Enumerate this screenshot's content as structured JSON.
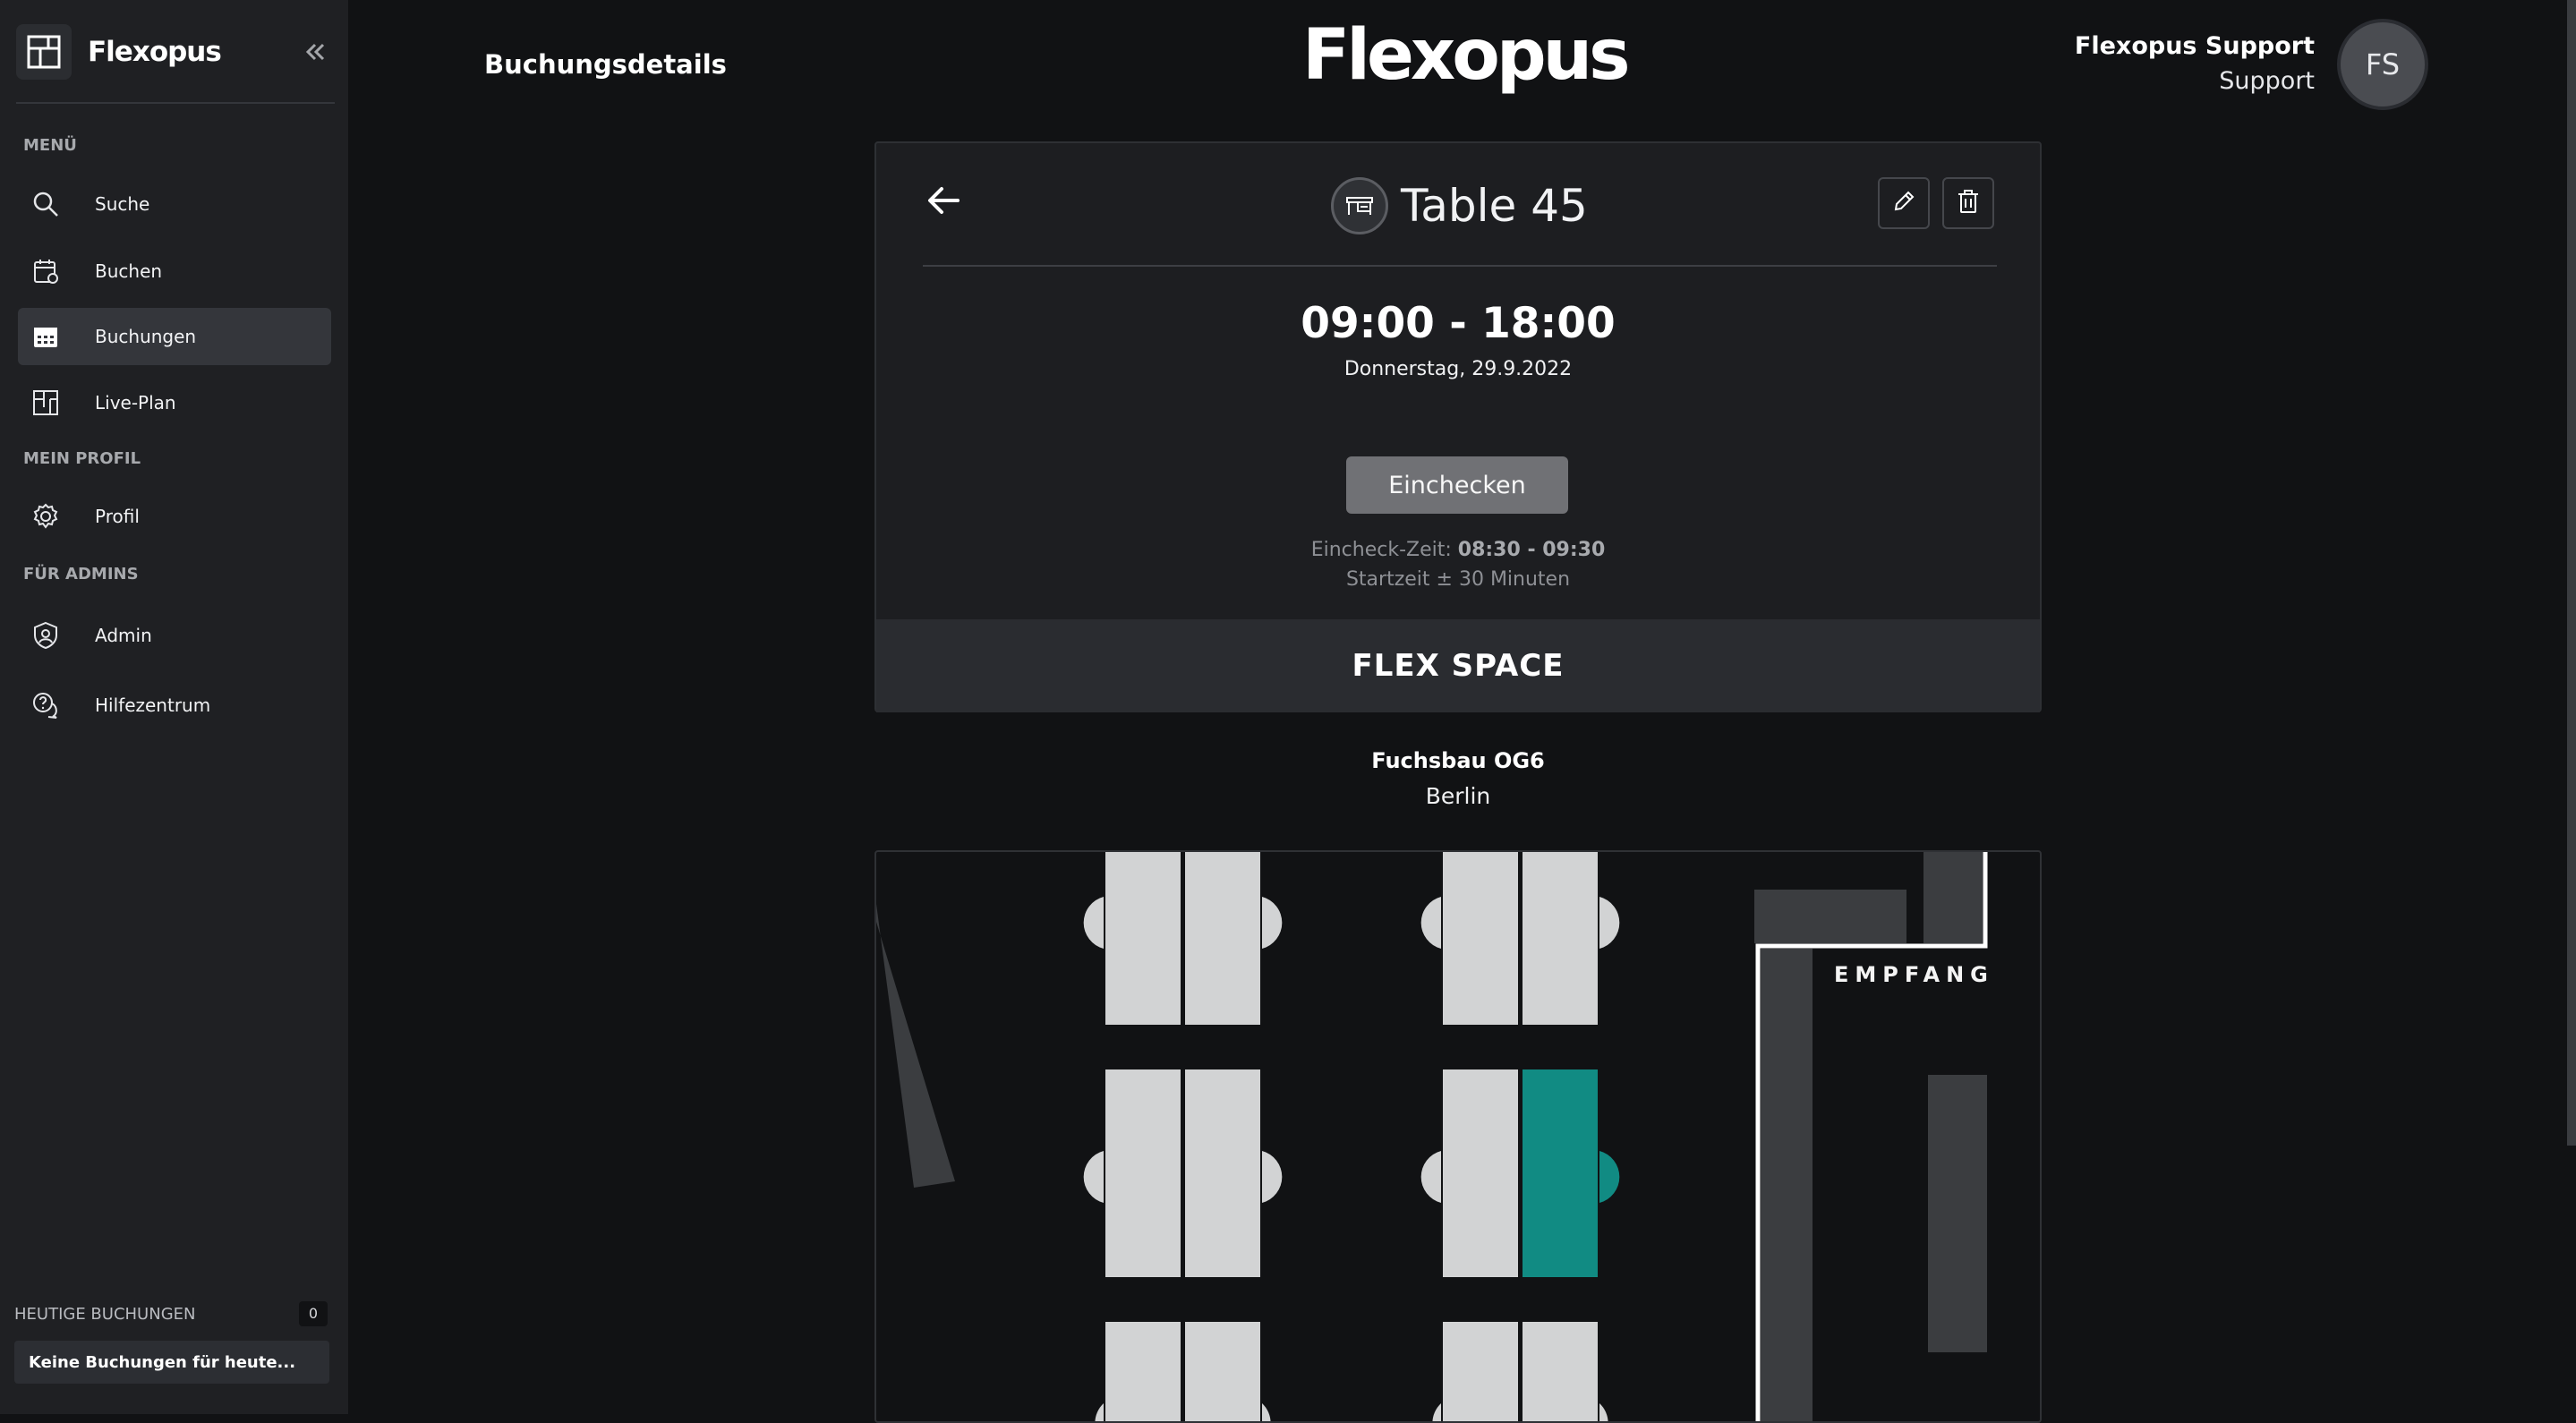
{
  "sidebar": {
    "brand": "Flexopus",
    "sections": {
      "menu": "MENÜ",
      "profile": "MEIN PROFIL",
      "admins": "FÜR ADMINS"
    },
    "items": {
      "search": "Suche",
      "book": "Buchen",
      "bookings": "Buchungen",
      "liveplan": "Live-Plan",
      "profile": "Profil",
      "admin": "Admin",
      "help": "Hilfezentrum"
    },
    "today": {
      "title": "HEUTIGE BUCHUNGEN",
      "count": "0",
      "empty": "Keine Buchungen für heute..."
    }
  },
  "header": {
    "title": "Buchungsdetails",
    "logo": "Flexopus",
    "user": {
      "name": "Flexopus Support",
      "role": "Support",
      "initials": "FS"
    }
  },
  "booking": {
    "table_name": "Table 45",
    "time": "09:00 - 18:00",
    "date": "Donnerstag, 29.9.2022",
    "checkin_button": "Einchecken",
    "checkin_label": "Eincheck-Zeit: ",
    "checkin_range": "08:30 - 09:30",
    "checkin_note": "Startzeit ± 30 Minuten",
    "space": "FLEX SPACE"
  },
  "location": {
    "building": "Fuchsbau OG6",
    "city": "Berlin"
  },
  "floorplan": {
    "reception_label": "EMPFANG",
    "highlight_color": "#118b83"
  }
}
